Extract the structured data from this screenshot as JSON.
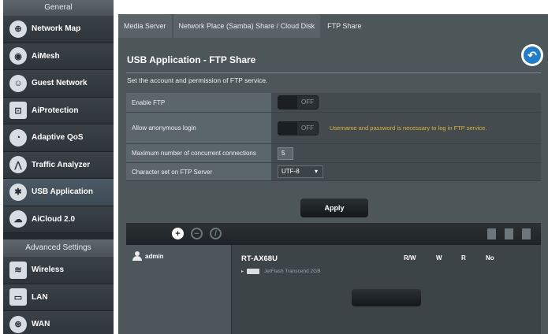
{
  "sidebar": {
    "general_label": "General",
    "items": [
      {
        "label": "Network Map",
        "icon": "network-map-icon"
      },
      {
        "label": "AiMesh",
        "icon": "aimesh-icon"
      },
      {
        "label": "Guest Network",
        "icon": "guest-network-icon"
      },
      {
        "label": "AiProtection",
        "icon": "lock-icon"
      },
      {
        "label": "Adaptive QoS",
        "icon": "speedometer-icon"
      },
      {
        "label": "Traffic Analyzer",
        "icon": "chart-icon"
      },
      {
        "label": "USB Application",
        "icon": "puzzle-icon",
        "active": true
      },
      {
        "label": "AiCloud 2.0",
        "icon": "cloud-icon"
      }
    ],
    "advanced_label": "Advanced Settings",
    "advanced_items": [
      {
        "label": "Wireless",
        "icon": "wifi-icon"
      },
      {
        "label": "LAN",
        "icon": "lan-icon"
      },
      {
        "label": "WAN",
        "icon": "globe-icon"
      }
    ]
  },
  "tabs": [
    {
      "label": "Media Server"
    },
    {
      "label": "Network Place (Samba) Share / Cloud Disk"
    },
    {
      "label": "FTP Share",
      "active": true
    }
  ],
  "page": {
    "title": "USB Application - FTP Share",
    "description": "Set the account and permission of FTP service."
  },
  "settings": {
    "enable_ftp": {
      "label": "Enable FTP",
      "state": "OFF"
    },
    "anonymous": {
      "label": "Allow anonymous login",
      "state": "OFF",
      "hint": "Username and password is necessary to log in FTP service."
    },
    "max_connections": {
      "label": "Maximum number of concurrent connections",
      "value": "5"
    },
    "charset": {
      "label": "Character set on FTP Server",
      "value": "UTF-8"
    }
  },
  "apply_label": "Apply",
  "share_panel": {
    "user": "admin",
    "device": "RT-AX68U",
    "columns": [
      "R/W",
      "W",
      "R",
      "No"
    ],
    "disk": "JetFlash Transcend 2GB"
  },
  "colors": {
    "accent": "#1f7dc9",
    "hint": "#e1b23a",
    "background": "#4d5659"
  }
}
